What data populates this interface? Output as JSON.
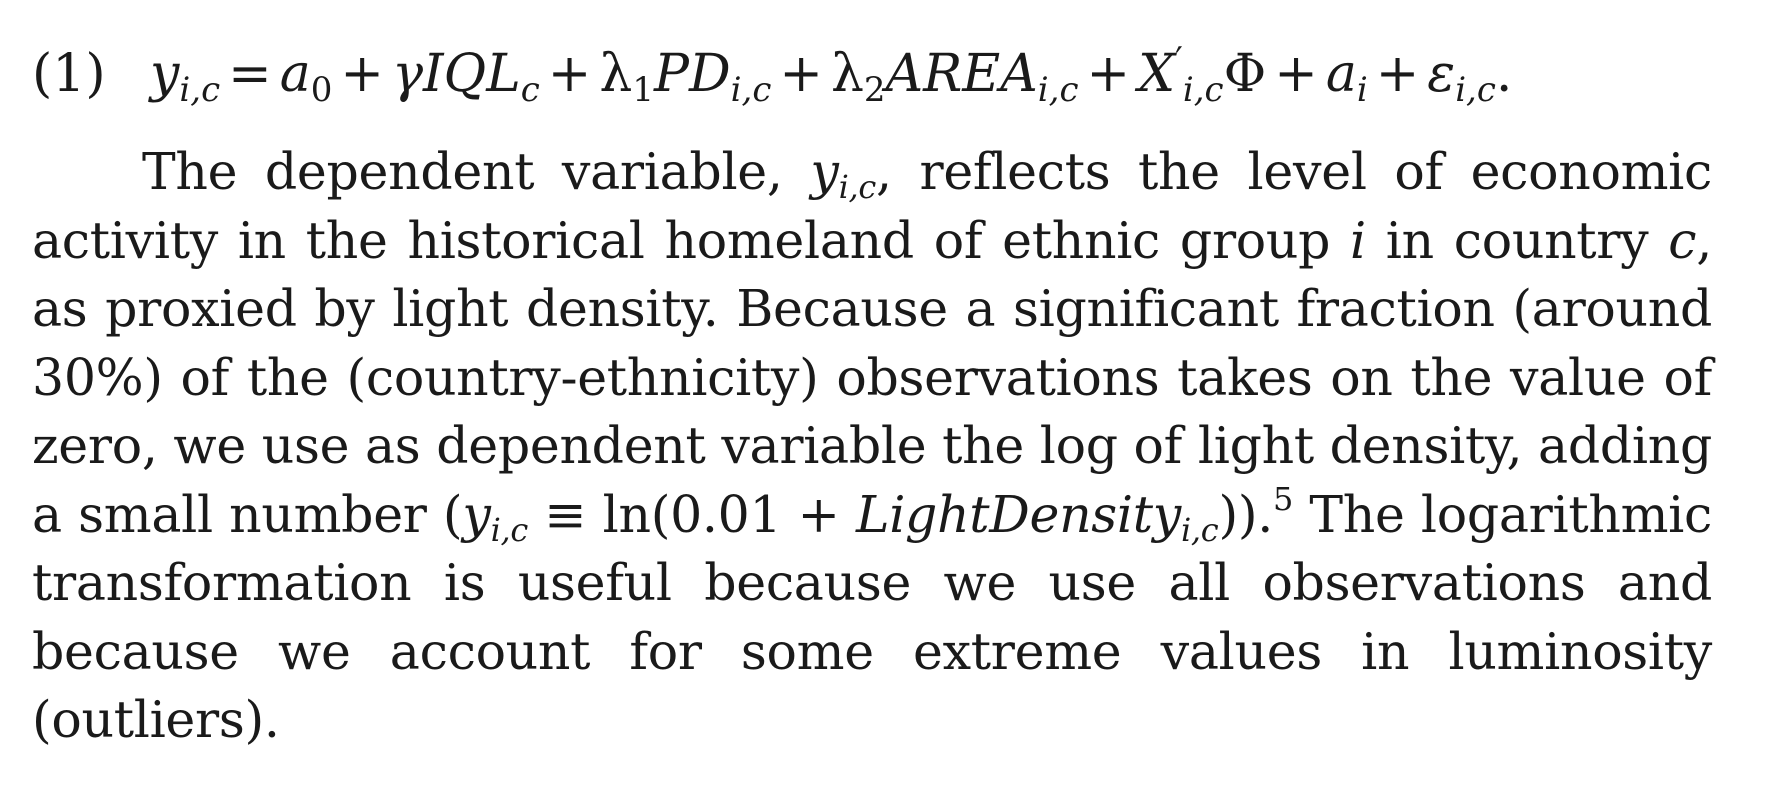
{
  "equation": {
    "number": "(1)",
    "lhs_var": "y",
    "lhs_sub": "i,c",
    "eq": "=",
    "a0": "a",
    "a0_sub": "0",
    "plus": "+",
    "gamma_term": "γIQL",
    "gamma_sub": "c",
    "lambda1": "λ",
    "lambda1_sub": "1",
    "pd": "PD",
    "pd_sub": "i,c",
    "lambda2": "λ",
    "lambda2_sub": "2",
    "area": "AREA",
    "area_sub": "i,c",
    "x": "X",
    "x_sup": "′",
    "x_sub": "i,c",
    "phi": "Φ",
    "ai": "a",
    "ai_sub": "i",
    "eps": "ε",
    "eps_sub": "i,c",
    "period": "."
  },
  "paragraph": {
    "t1": "The dependent variable, ",
    "y1": "y",
    "y1_sub": "i,c",
    "t2": ", reflects the level of economic activity in the historical homeland of ethnic group ",
    "i_var": "i",
    "t3": " in country ",
    "c_var": "c",
    "t4": ", as proxied by light density. Because a significant fraction (around 30%) of the (country-ethnicity) observations takes on the value of zero, we use as dependent variable the log of light density, adding a small number (",
    "y2": "y",
    "y2_sub": "i,c",
    "t5": " ≡ ln(0.01 + ",
    "light": "LightDensity",
    "light_sub": "i,c",
    "t6": ")).",
    "footnote": "5",
    "t7": " The logarithmic transformation is useful because we use all observations and because we account for some extreme values in luminosity (outliers)."
  }
}
